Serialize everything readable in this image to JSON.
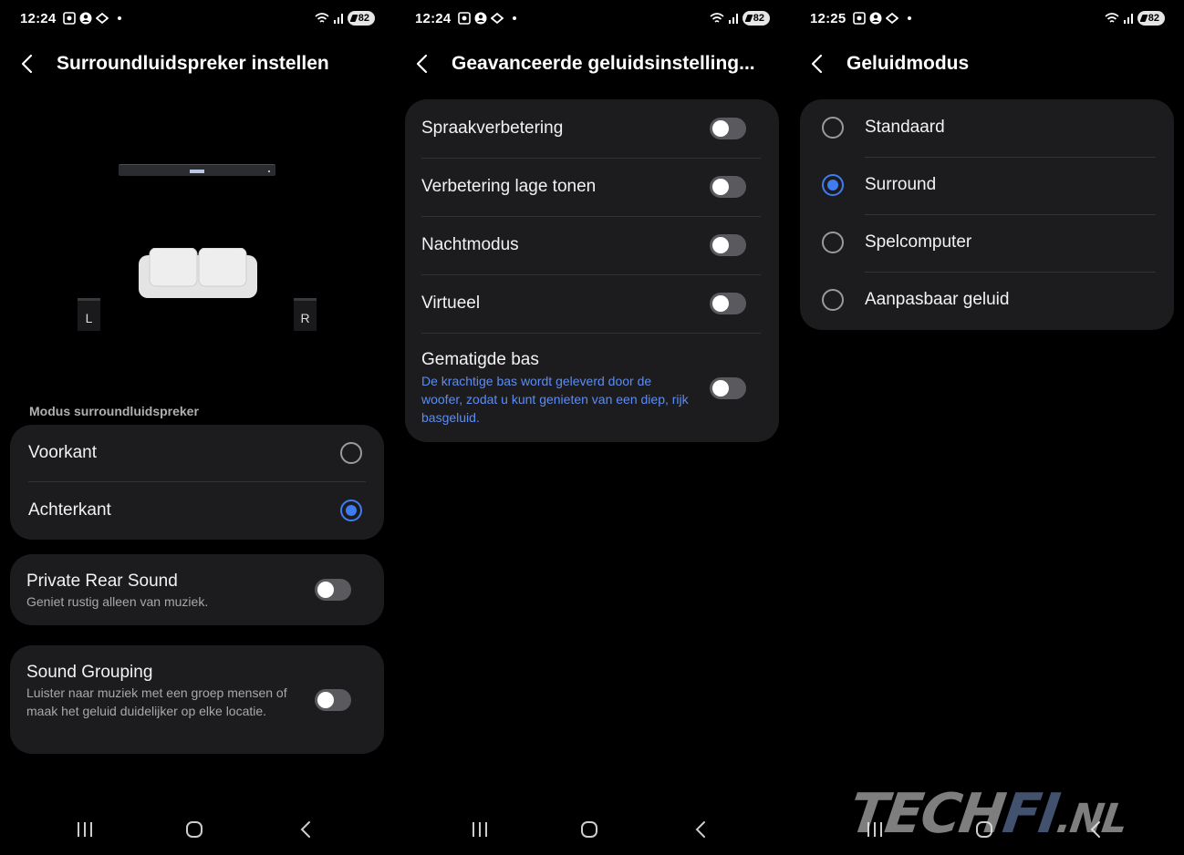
{
  "screen1": {
    "status": {
      "time": "12:24",
      "battery": "82"
    },
    "title": "Surroundluidspreker instellen",
    "illustration": {
      "left_label": "L",
      "right_label": "R"
    },
    "mode_section_label": "Modus surroundluidspreker",
    "mode_options": [
      {
        "label": "Voorkant",
        "selected": false
      },
      {
        "label": "Achterkant",
        "selected": true
      }
    ],
    "private_rear": {
      "title": "Private Rear Sound",
      "subtitle": "Geniet rustig alleen van muziek.",
      "on": false
    },
    "sound_grouping": {
      "title": "Sound Grouping",
      "subtitle": "Luister naar muziek met een groep mensen of maak het geluid duidelijker op elke locatie.",
      "on": false
    }
  },
  "screen2": {
    "status": {
      "time": "12:24",
      "battery": "82"
    },
    "title": "Geavanceerde geluidsinstelling...",
    "toggles": [
      {
        "label": "Spraakverbetering",
        "on": false
      },
      {
        "label": "Verbetering lage tonen",
        "on": false
      },
      {
        "label": "Nachtmodus",
        "on": false
      },
      {
        "label": "Virtueel",
        "on": false
      }
    ],
    "moderate_bass": {
      "label": "Gematigde bas",
      "description": "De krachtige bas wordt geleverd door de woofer, zodat u kunt genieten van een diep, rijk basgeluid.",
      "on": false
    }
  },
  "screen3": {
    "status": {
      "time": "12:25",
      "battery": "82"
    },
    "title": "Geluidmodus",
    "options": [
      {
        "label": "Standaard",
        "selected": false
      },
      {
        "label": "Surround",
        "selected": true
      },
      {
        "label": "Spelcomputer",
        "selected": false
      },
      {
        "label": "Aanpasbaar geluid",
        "selected": false
      }
    ]
  },
  "watermark": {
    "part1": "TECH",
    "part2": "FI",
    "part3": ".NL"
  },
  "colors": {
    "accent": "#3f7cf2",
    "card": "#1c1c1e",
    "background": "#000000",
    "link": "#5b8cf5"
  },
  "icons": [
    "back-chevron-icon",
    "recent-apps-icon",
    "home-icon",
    "nav-back-icon",
    "wifi-icon",
    "signal-icon",
    "screen-record-icon",
    "account-icon",
    "cast-icon"
  ]
}
